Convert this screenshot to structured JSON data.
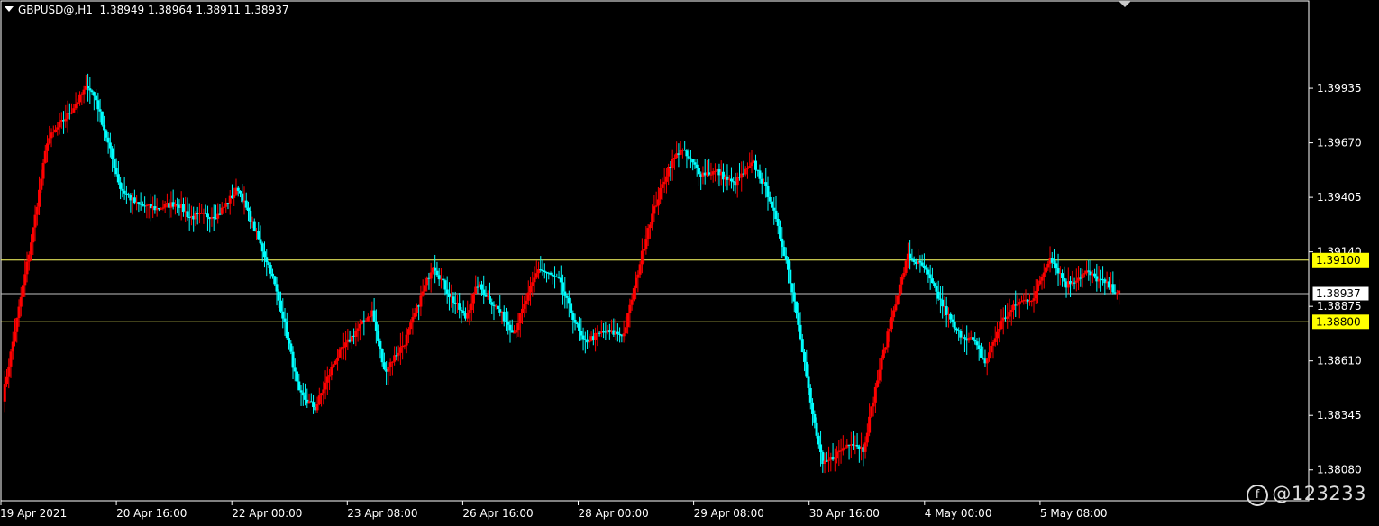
{
  "header": {
    "symbol_tf": "GBPUSD@,H1",
    "ohlc": "1.38949 1.38964 1.38911 1.38937"
  },
  "watermark": "@123233",
  "colors": {
    "background": "#000000",
    "bull": "#ff0000",
    "bear": "#00ffff",
    "level_line": "#ffff66",
    "level_box": "#ffff00",
    "bid_line": "#c0c0c0",
    "axis": "#ffffff"
  },
  "chart_data": {
    "type": "candlestick",
    "symbol": "GBPUSD",
    "timeframe": "H1",
    "y_ticks": [
      "1.39935",
      "1.39670",
      "1.39405",
      "1.39140",
      "1.38875",
      "1.38610",
      "1.38345",
      "1.38080"
    ],
    "x_ticks": [
      "19 Apr 2021",
      "20 Apr 16:00",
      "22 Apr 00:00",
      "23 Apr 08:00",
      "26 Apr 16:00",
      "28 Apr 00:00",
      "29 Apr 08:00",
      "30 Apr 16:00",
      "4 May 00:00",
      "5 May 08:00"
    ],
    "ylim": [
      1.3793,
      1.4036
    ],
    "horizontal_levels": [
      {
        "value": 1.391,
        "label": "1.39100"
      },
      {
        "value": 1.388,
        "label": "1.38800"
      }
    ],
    "current_price": {
      "value": 1.38937,
      "label": "1.38937"
    },
    "anchors": [
      [
        0,
        1.3843
      ],
      [
        14,
        1.3919
      ],
      [
        22,
        1.3968
      ],
      [
        34,
        1.3983
      ],
      [
        42,
        1.3995
      ],
      [
        46,
        1.3988
      ],
      [
        58,
        1.3945
      ],
      [
        66,
        1.3937
      ],
      [
        76,
        1.3935
      ],
      [
        86,
        1.3938
      ],
      [
        92,
        1.3931
      ],
      [
        106,
        1.3932
      ],
      [
        116,
        1.3945
      ],
      [
        132,
        1.3905
      ],
      [
        138,
        1.3883
      ],
      [
        146,
        1.3845
      ],
      [
        154,
        1.3838
      ],
      [
        164,
        1.3862
      ],
      [
        176,
        1.3878
      ],
      [
        182,
        1.3885
      ],
      [
        188,
        1.3856
      ],
      [
        198,
        1.387
      ],
      [
        212,
        1.3908
      ],
      [
        220,
        1.3893
      ],
      [
        228,
        1.3882
      ],
      [
        234,
        1.3898
      ],
      [
        244,
        1.3886
      ],
      [
        252,
        1.3875
      ],
      [
        264,
        1.3906
      ],
      [
        274,
        1.39
      ],
      [
        286,
        1.387
      ],
      [
        296,
        1.3875
      ],
      [
        306,
        1.3874
      ],
      [
        318,
        1.3926
      ],
      [
        328,
        1.3955
      ],
      [
        334,
        1.3964
      ],
      [
        344,
        1.3952
      ],
      [
        352,
        1.3953
      ],
      [
        360,
        1.3947
      ],
      [
        370,
        1.3957
      ],
      [
        378,
        1.394
      ],
      [
        386,
        1.391
      ],
      [
        392,
        1.388
      ],
      [
        398,
        1.384
      ],
      [
        404,
        1.381
      ],
      [
        410,
        1.3815
      ],
      [
        418,
        1.3822
      ],
      [
        424,
        1.3818
      ],
      [
        432,
        1.3857
      ],
      [
        440,
        1.389
      ],
      [
        446,
        1.3912
      ],
      [
        454,
        1.3906
      ],
      [
        462,
        1.389
      ],
      [
        470,
        1.3875
      ],
      [
        478,
        1.3871
      ],
      [
        484,
        1.386
      ],
      [
        492,
        1.388
      ],
      [
        500,
        1.3889
      ],
      [
        508,
        1.3892
      ],
      [
        516,
        1.3912
      ],
      [
        524,
        1.3898
      ],
      [
        534,
        1.3904
      ],
      [
        544,
        1.3898
      ],
      [
        550,
        1.3894
      ]
    ]
  }
}
